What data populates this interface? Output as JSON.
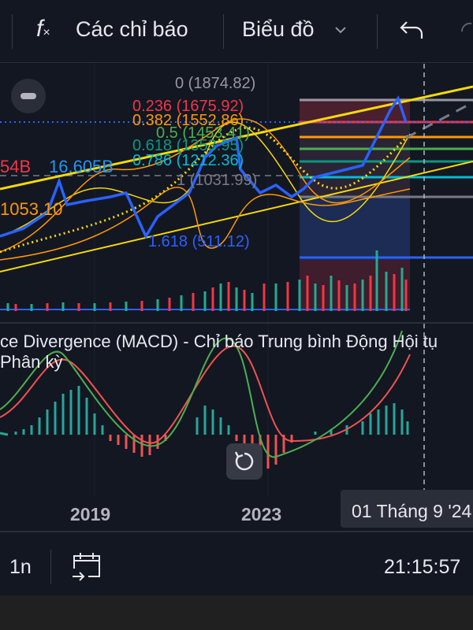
{
  "toolbar": {
    "indicators_label": "Các chỉ báo",
    "chart_label": "Biểu đồ"
  },
  "chart": {
    "fib_levels": [
      {
        "label": "0 (1874.82)",
        "color": "#9598a1"
      },
      {
        "label": "0.236 (1675.92)",
        "color": "#f23645"
      },
      {
        "label": "0.382 (1552.86)",
        "color": "#ff9800"
      },
      {
        "label": "0.5 (1453.41)",
        "color": "#4caf50"
      },
      {
        "label": "0.618 (1353.95)",
        "color": "#089981"
      },
      {
        "label": "0.786 (1212.36)",
        "color": "#00bcd4"
      },
      {
        "label": "1 (1031.99)",
        "color": "#787b86"
      },
      {
        "label": "1.618 (511.12)",
        "color": "#2962ff"
      }
    ],
    "volume_label_red": "54B",
    "volume_label_blue": "16.605B",
    "price_label": "1053.10"
  },
  "macd": {
    "title": "ce Divergence (MACD) - Chỉ báo Trung bình Động Hội tụ Phân kỳ"
  },
  "axis": {
    "years": [
      "2019",
      "2023"
    ],
    "crosshair_date": "01 Tháng 9 '24"
  },
  "bottom": {
    "interval": "1n",
    "time": "21:15:57"
  }
}
